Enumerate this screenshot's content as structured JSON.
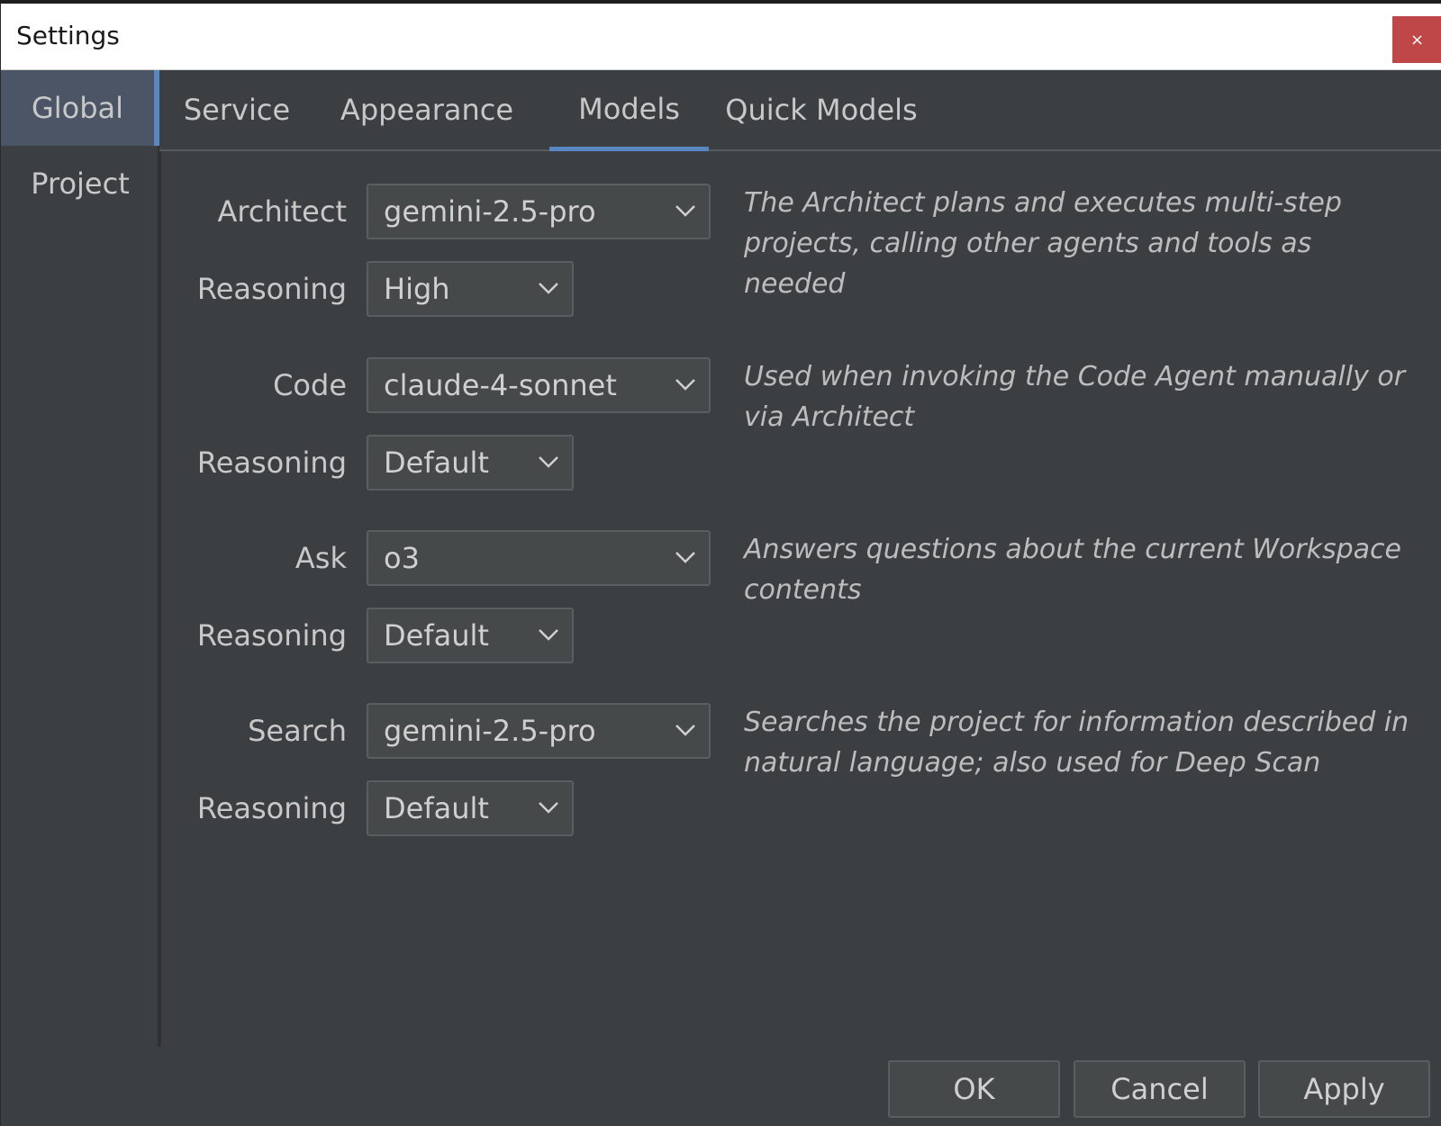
{
  "window": {
    "title": "Settings",
    "close_label": "×"
  },
  "sidebar": {
    "items": [
      {
        "label": "Global",
        "active": true
      },
      {
        "label": "Project",
        "active": false
      }
    ]
  },
  "tabs": [
    {
      "label": "Service",
      "active": false
    },
    {
      "label": "Appearance",
      "active": false
    },
    {
      "label": "Models",
      "active": true
    },
    {
      "label": "Quick Models",
      "active": false
    }
  ],
  "models": [
    {
      "label": "Architect",
      "model": "gemini-2.5-pro",
      "reasoning_label": "Reasoning",
      "reasoning": "High",
      "description": "The Architect plans and executes multi-step projects, calling other agents and tools as needed"
    },
    {
      "label": "Code",
      "model": "claude-4-sonnet",
      "reasoning_label": "Reasoning",
      "reasoning": "Default",
      "description": "Used when invoking the Code Agent manually or via Architect"
    },
    {
      "label": "Ask",
      "model": "o3",
      "reasoning_label": "Reasoning",
      "reasoning": "Default",
      "description": "Answers questions about the current Workspace contents"
    },
    {
      "label": "Search",
      "model": "gemini-2.5-pro",
      "reasoning_label": "Reasoning",
      "reasoning": "Default",
      "description": "Searches the project for information described in natural language; also used for Deep Scan"
    }
  ],
  "buttons": {
    "ok": "OK",
    "cancel": "Cancel",
    "apply": "Apply"
  },
  "colors": {
    "background": "#3c3f41",
    "accent": "#5a86c4",
    "sidebar_active": "#4b5566",
    "close_button": "#c04747"
  }
}
